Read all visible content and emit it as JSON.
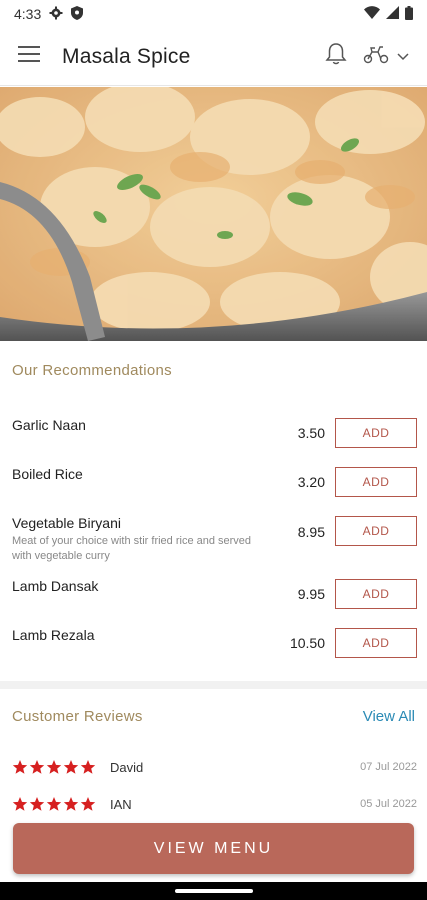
{
  "status_bar": {
    "time": "4:33"
  },
  "app_bar": {
    "title": "Masala Spice"
  },
  "recommendations": {
    "title": "Our Recommendations",
    "items": [
      {
        "name": "Garlic Naan",
        "description": "",
        "price": "3.50",
        "button": "ADD"
      },
      {
        "name": "Boiled Rice",
        "description": "",
        "price": "3.20",
        "button": "ADD"
      },
      {
        "name": "Vegetable Biryani",
        "description": "Meat of your choice with stir fried rice and served with vegetable curry",
        "price": "8.95",
        "button": "ADD"
      },
      {
        "name": "Lamb Dansak",
        "description": "",
        "price": "9.95",
        "button": "ADD"
      },
      {
        "name": "Lamb Rezala",
        "description": "",
        "price": "10.50",
        "button": "ADD"
      }
    ]
  },
  "reviews": {
    "title": "Customer Reviews",
    "view_all": "View All",
    "items": [
      {
        "name": "David",
        "date": "07 Jul 2022",
        "rating": 5
      },
      {
        "name": "IAN",
        "date": "05 Jul 2022",
        "rating": 5
      }
    ]
  },
  "view_menu_label": "VIEW MENU",
  "colors": {
    "accent": "#b9685a",
    "section_title": "#a08a5e",
    "link": "#2a8ab5",
    "star": "#d62020"
  },
  "icons": [
    "menu-icon",
    "notification-bell-icon",
    "scooter-icon",
    "chevron-down-icon",
    "star-icon"
  ]
}
